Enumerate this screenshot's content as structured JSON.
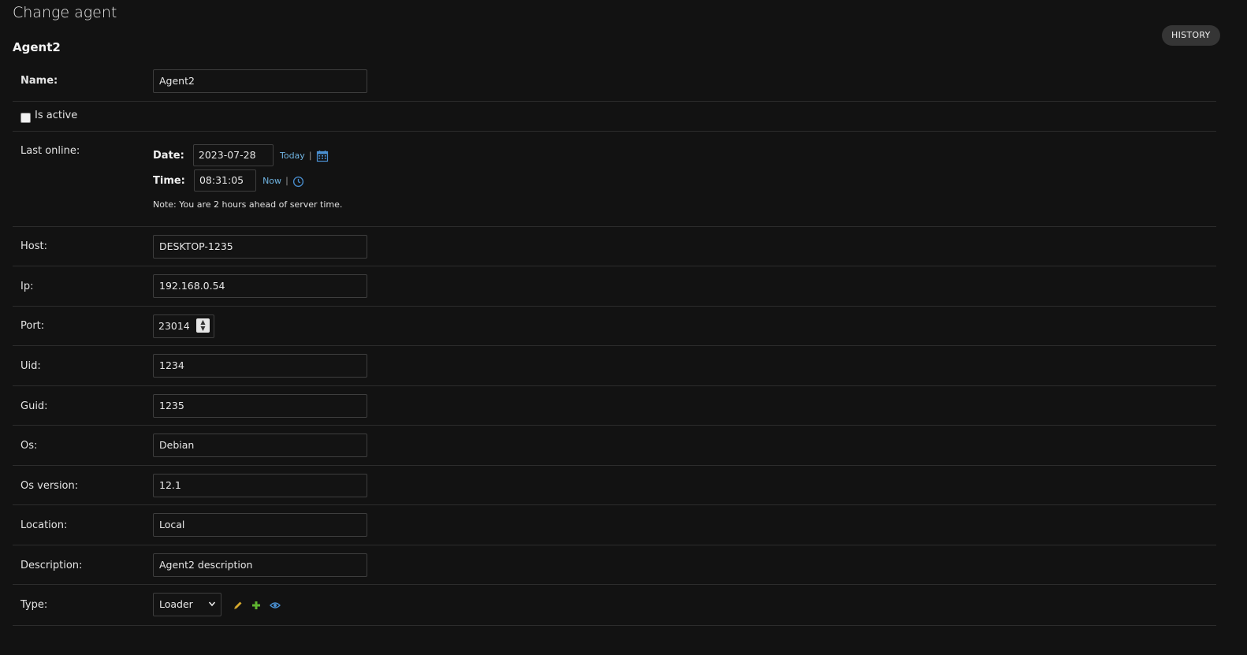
{
  "page": {
    "title": "Change agent",
    "object_title": "Agent2",
    "history_label": "HISTORY"
  },
  "form": {
    "name": {
      "label": "Name:",
      "value": "Agent2"
    },
    "is_active": {
      "label": "Is active",
      "checked": false
    },
    "last_online": {
      "label": "Last online:",
      "date_label": "Date:",
      "date_value": "2023-07-28",
      "today_link": "Today",
      "time_label": "Time:",
      "time_value": "08:31:05",
      "now_link": "Now",
      "separator": "|",
      "note": "Note: You are 2 hours ahead of server time."
    },
    "host": {
      "label": "Host:",
      "value": "DESKTOP-1235"
    },
    "ip": {
      "label": "Ip:",
      "value": "192.168.0.54"
    },
    "port": {
      "label": "Port:",
      "value": "23014"
    },
    "uid": {
      "label": "Uid:",
      "value": "1234"
    },
    "guid": {
      "label": "Guid:",
      "value": "1235"
    },
    "os": {
      "label": "Os:",
      "value": "Debian"
    },
    "os_version": {
      "label": "Os version:",
      "value": "12.1"
    },
    "location": {
      "label": "Location:",
      "value": "Local"
    },
    "description": {
      "label": "Description:",
      "value": "Agent2 description"
    },
    "type": {
      "label": "Type:",
      "value": "Loader"
    }
  },
  "icons": {
    "calendar": "calendar-icon",
    "clock": "clock-icon",
    "edit": "pencil-icon",
    "add": "plus-icon",
    "view": "eye-icon",
    "spinner": "spinner-icon",
    "dropdown": "chevron-down-icon"
  },
  "colors": {
    "background": "#121212",
    "link": "#6fb3e0",
    "edit_icon": "#d4a72c",
    "add_icon": "#5fb530",
    "view_icon": "#4a8fd0",
    "history_button": "#353535"
  }
}
